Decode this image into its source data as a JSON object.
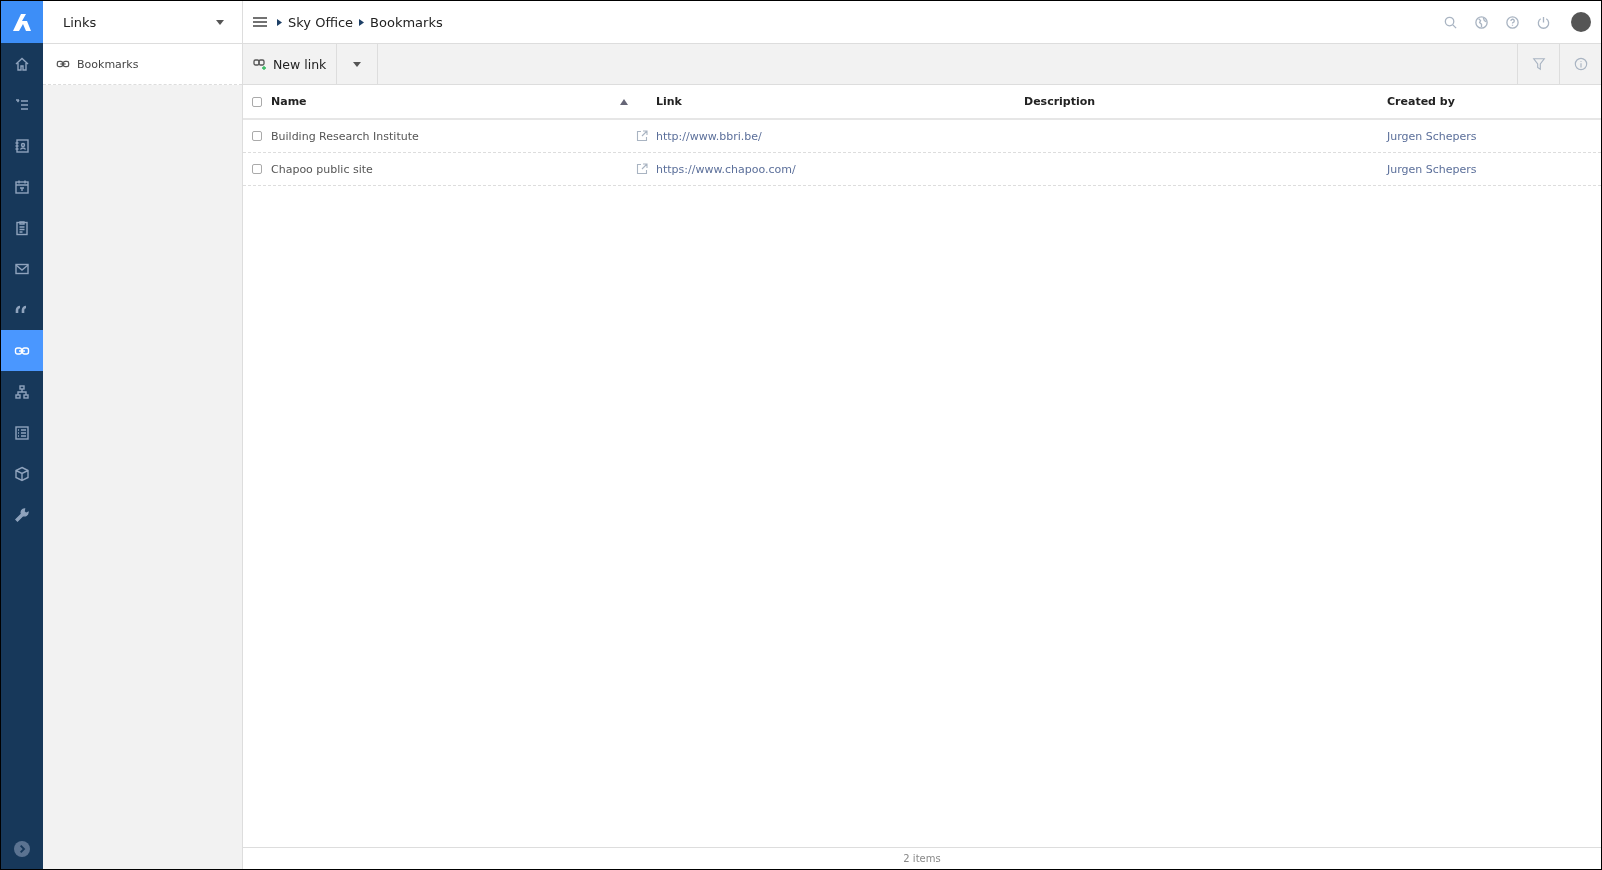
{
  "nav_rail": {
    "items": [
      {
        "selected": false
      },
      {
        "selected": false
      },
      {
        "selected": false
      },
      {
        "selected": false
      },
      {
        "selected": false
      },
      {
        "selected": false
      },
      {
        "selected": false
      },
      {
        "selected": true
      },
      {
        "selected": false
      },
      {
        "selected": false
      },
      {
        "selected": false
      },
      {
        "selected": false
      }
    ]
  },
  "side_panel": {
    "title": "Links",
    "items": [
      {
        "label": "Bookmarks",
        "selected": true
      }
    ]
  },
  "breadcrumb": [
    "Sky Office",
    "Bookmarks"
  ],
  "toolbar": {
    "new_button": "New link"
  },
  "table": {
    "select_all": {
      "checked": false
    },
    "columns": [
      {
        "label": "Name",
        "sorted": true
      },
      {
        "label": "Link",
        "sorted": false
      },
      {
        "label": "Description",
        "sorted": false
      },
      {
        "label": "Created by",
        "sorted": false
      }
    ],
    "rows": [
      {
        "checked": false,
        "name": "Building Research Institute",
        "link": "http://www.bbri.be/",
        "created_by": "Jurgen Schepers"
      },
      {
        "checked": false,
        "name": "Chapoo public site",
        "link": "https://www.chapoo.com/",
        "created_by": "Jurgen Schepers"
      }
    ]
  },
  "status_bar": {
    "count": "2 items"
  }
}
